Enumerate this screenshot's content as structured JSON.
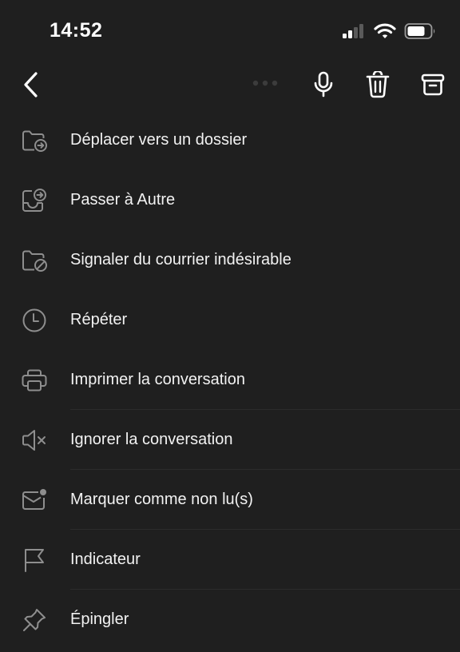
{
  "status_bar": {
    "time": "14:52"
  },
  "toolbar": {
    "back_icon": "chevron-left-icon",
    "more_icon": "more-dots-icon",
    "mic_icon": "microphone-icon",
    "delete_icon": "trash-icon",
    "archive_icon": "archive-icon"
  },
  "menu": {
    "items": [
      {
        "label": "Déplacer vers un dossier",
        "icon": "folder-move-icon"
      },
      {
        "label": "Passer à Autre",
        "icon": "inbox-move-icon"
      },
      {
        "label": "Signaler du courrier indésirable",
        "icon": "folder-block-icon"
      },
      {
        "label": "Répéter",
        "icon": "clock-icon"
      },
      {
        "label": "Imprimer la conversation",
        "icon": "printer-icon"
      },
      {
        "label": "Ignorer la conversation",
        "icon": "speaker-mute-icon"
      },
      {
        "label": "Marquer comme non lu(s)",
        "icon": "mail-unread-icon"
      },
      {
        "label": "Indicateur",
        "icon": "flag-icon"
      },
      {
        "label": "Épingler",
        "icon": "pin-icon"
      }
    ]
  },
  "colors": {
    "background": "#1f1f1f",
    "text": "#f2f2f2",
    "icon": "#8e8e8e",
    "toolbar_icon": "#ffffff"
  }
}
